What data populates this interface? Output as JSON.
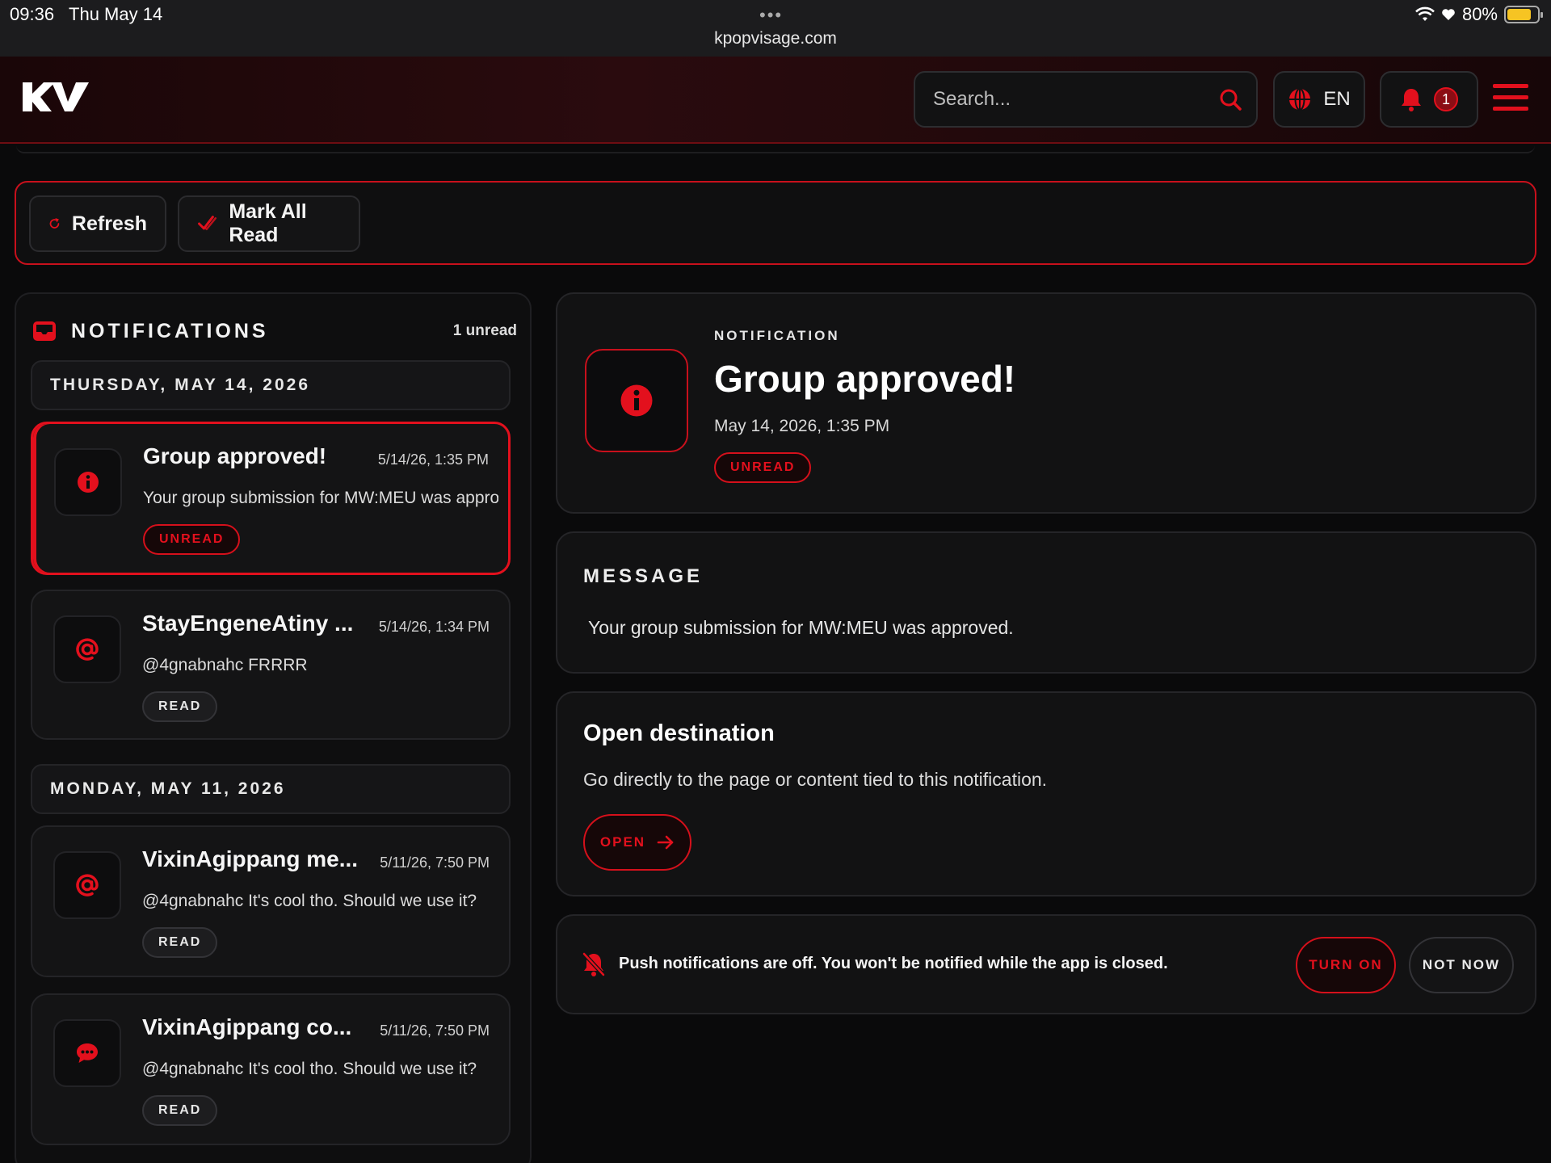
{
  "status_bar": {
    "time": "09:36",
    "date": "Thu May 14",
    "dots": "•••",
    "url": "kpopvisage.com",
    "battery": "80%"
  },
  "header": {
    "logo_icon": "kv-logo",
    "search_placeholder": "Search...",
    "language": "EN",
    "notification_count": "1"
  },
  "toolbar": {
    "refresh_label": "Refresh",
    "mark_all_label": "Mark All Read"
  },
  "notifications": {
    "title": "NOTIFICATIONS",
    "unread_count": "1 unread",
    "groups": [
      {
        "date": "THURSDAY, MAY 14, 2026",
        "items": [
          {
            "icon": "info-icon",
            "title": "Group approved!",
            "time": "5/14/26, 1:35 PM",
            "body": "Your group submission for MW:MEU was approved.",
            "status": "UNREAD"
          },
          {
            "icon": "at-icon",
            "title": "StayEngeneAtiny ...",
            "time": "5/14/26, 1:34 PM",
            "body": "@4gnabnahc FRRRR",
            "status": "READ"
          }
        ]
      },
      {
        "date": "MONDAY, MAY 11, 2026",
        "items": [
          {
            "icon": "at-icon",
            "title": "VixinAgippang me...",
            "time": "5/11/26, 7:50 PM",
            "body": "@4gnabnahc It's cool tho. Should we use it?",
            "status": "READ"
          },
          {
            "icon": "comment-icon",
            "title": "VixinAgippang co...",
            "time": "5/11/26, 7:50 PM",
            "body": "@4gnabnahc It's cool tho. Should we use it?",
            "status": "READ"
          }
        ]
      }
    ]
  },
  "detail": {
    "kicker": "NOTIFICATION",
    "title": "Group approved!",
    "date": "May 14, 2026, 1:35 PM",
    "status": "UNREAD"
  },
  "message": {
    "heading": "MESSAGE",
    "body": "Your group submission for MW:MEU was approved."
  },
  "destination": {
    "title": "Open destination",
    "description": "Go directly to the page or content tied to this notification.",
    "button": "OPEN"
  },
  "push": {
    "text": "Push notifications are off. You won't be notified while the app is closed.",
    "turn_on": "TURN ON",
    "not_now": "NOT NOW"
  },
  "colors": {
    "accent": "#e3101d",
    "background": "#0a0a0b",
    "card": "#121213"
  }
}
